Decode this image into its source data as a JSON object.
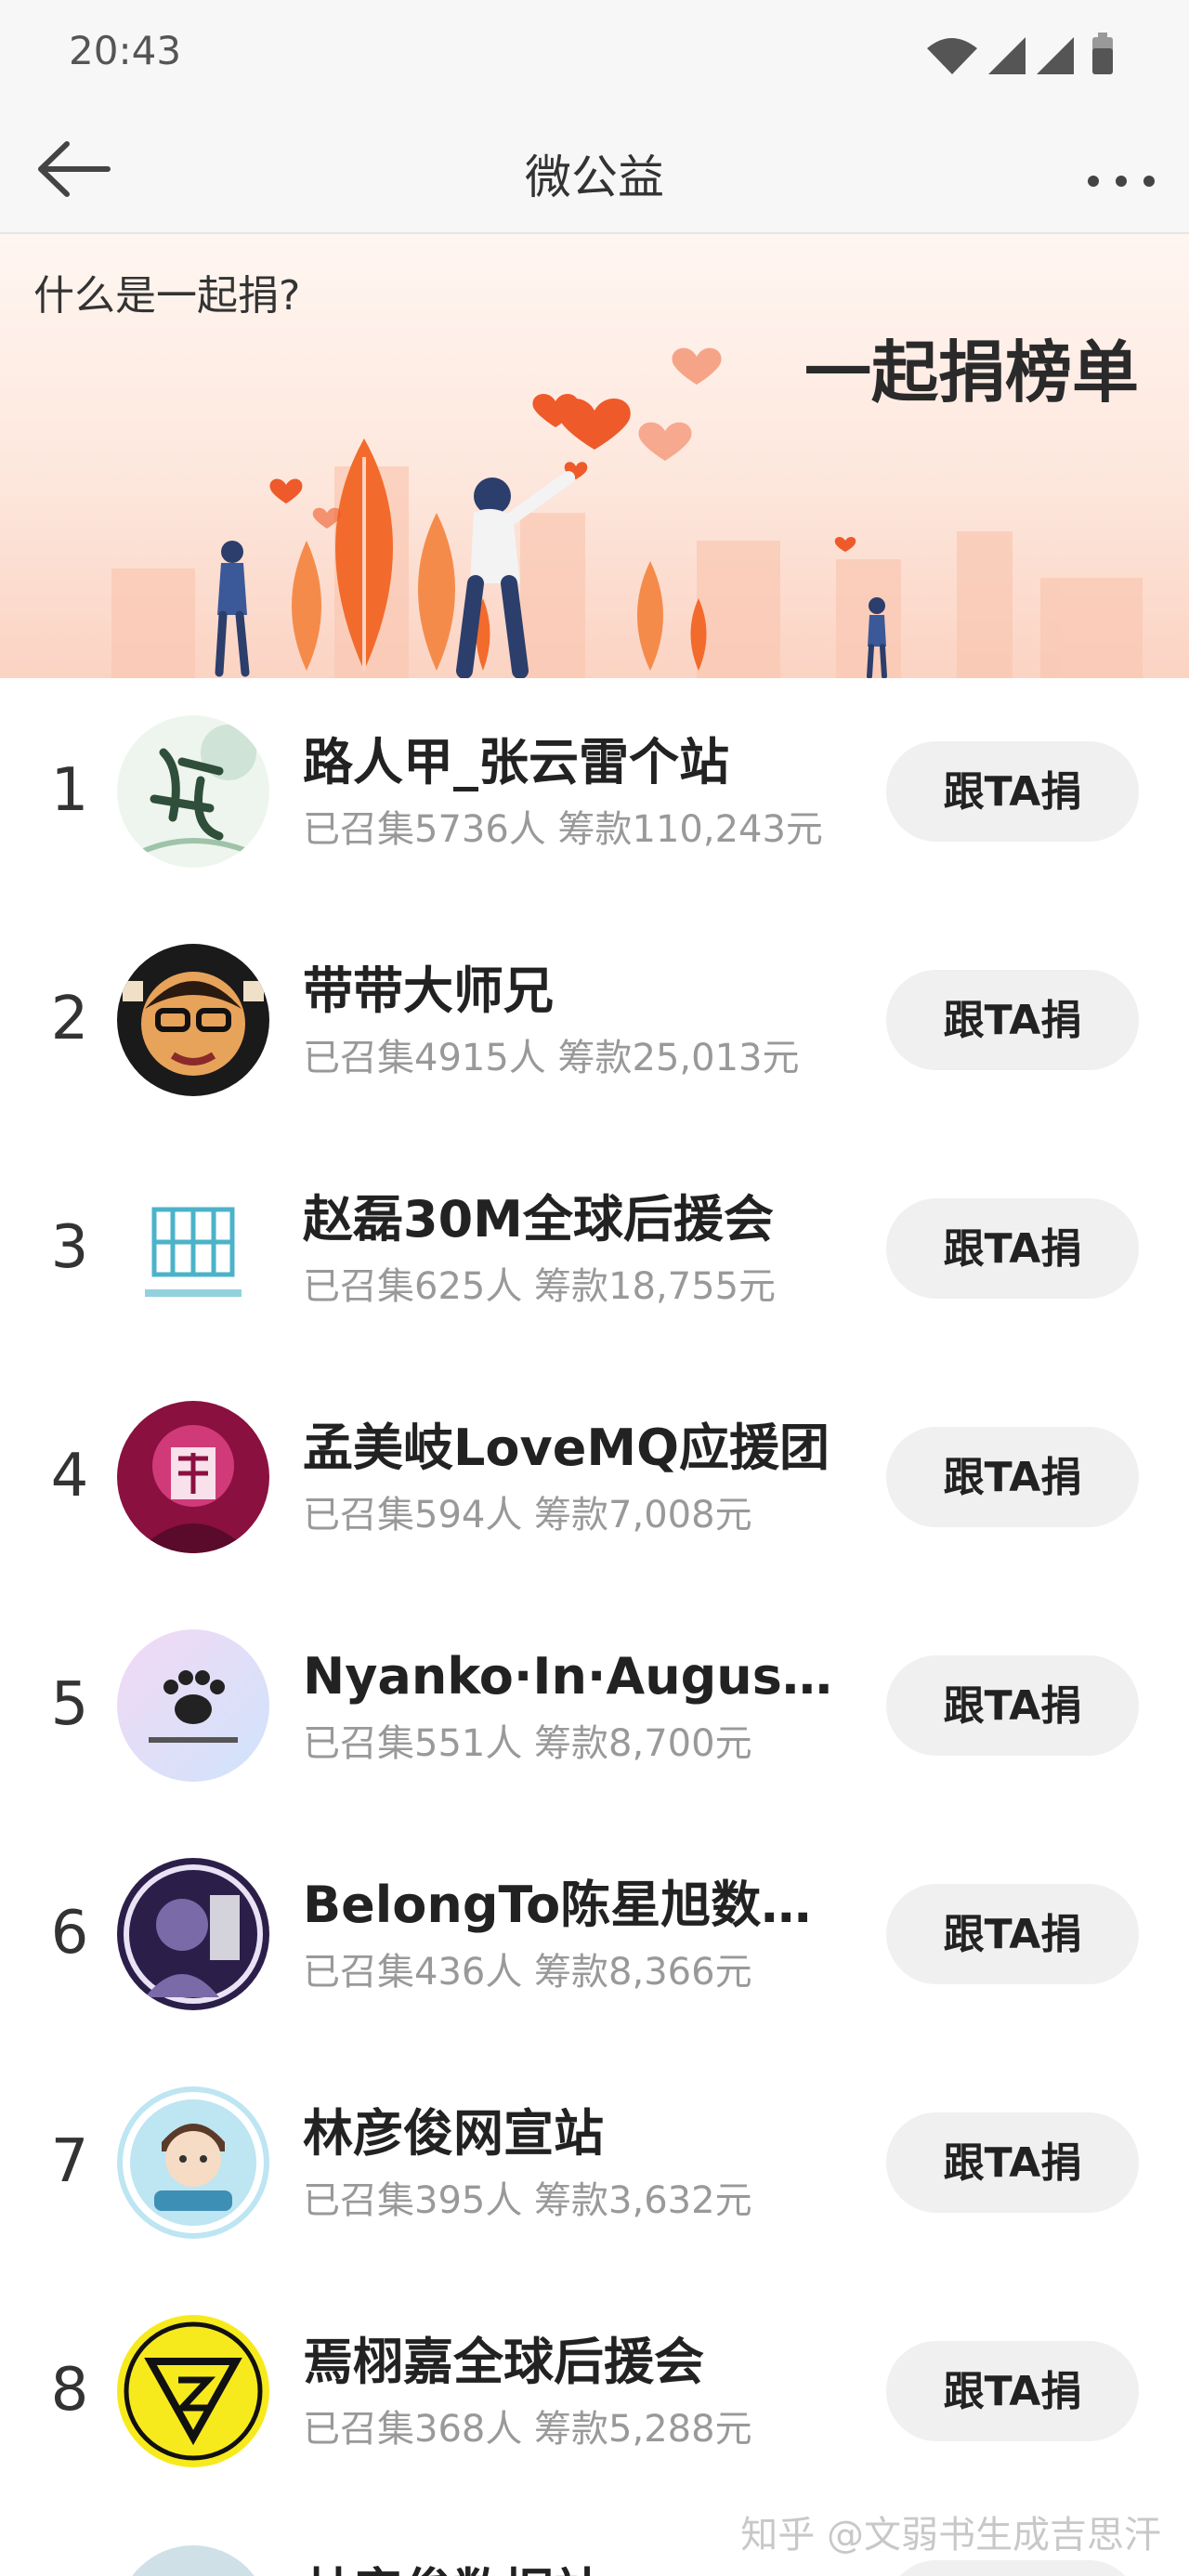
{
  "status_bar": {
    "time": "20:43",
    "icons": [
      "wifi-icon",
      "signal-icon",
      "signal-icon",
      "battery-icon"
    ]
  },
  "nav": {
    "back_icon": "arrow-left-icon",
    "title": "微公益",
    "more_icon": "more-horizontal-icon"
  },
  "banner": {
    "question": "什么是一起捐?",
    "title": "一起捐榜单",
    "accent": "#f26b2c"
  },
  "ranking": {
    "button_label": "跟TA捐",
    "items": [
      {
        "rank": "1",
        "name": "路人甲_张云雷个站",
        "stats": "已召集5736人 筹款110,243元",
        "avatar": "calligraphy-avatar"
      },
      {
        "rank": "2",
        "name": "带带大师兄",
        "stats": "已召集4915人 筹款25,013元",
        "avatar": "cartoon-face-avatar"
      },
      {
        "rank": "3",
        "name": "赵磊30M全球后援会",
        "stats": "已召集625人 筹款18,755元",
        "avatar": "logo-avatar"
      },
      {
        "rank": "4",
        "name": "孟美岐LoveMQ应援团",
        "stats": "已召集594人 筹款7,008元",
        "avatar": "portrait-avatar"
      },
      {
        "rank": "5",
        "name": "Nyanko·In·August丨蔡...",
        "stats": "已召集551人 筹款8,700元",
        "avatar": "paw-avatar"
      },
      {
        "rank": "6",
        "name": "BelongTo陈星旭数据站",
        "stats": "已召集436人 筹款8,366元",
        "avatar": "portrait-avatar"
      },
      {
        "rank": "7",
        "name": "林彦俊网宣站",
        "stats": "已召集395人 筹款3,632元",
        "avatar": "chibi-avatar"
      },
      {
        "rank": "8",
        "name": "焉栩嘉全球后援会",
        "stats": "已召集368人 筹款5,288元",
        "avatar": "triangle-logo-avatar"
      }
    ],
    "peek_name": "林彦俊数据站"
  },
  "watermark": "知乎 @文弱书生成吉思汗"
}
